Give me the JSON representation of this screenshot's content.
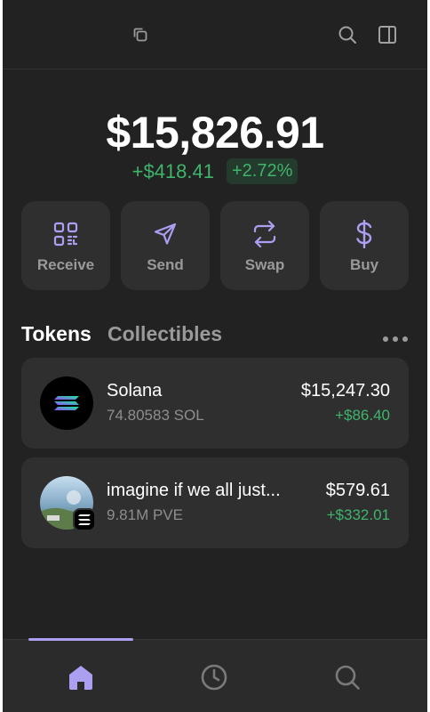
{
  "header": {
    "copy_icon": "copy-icon",
    "search_icon": "search-icon",
    "sidebar_icon": "sidebar-toggle-icon"
  },
  "balance": {
    "total": "$15,826.91",
    "change_amount": "+$418.41",
    "change_percent": "+2.72%"
  },
  "actions": [
    {
      "label": "Receive",
      "icon": "qr-code-icon"
    },
    {
      "label": "Send",
      "icon": "send-icon"
    },
    {
      "label": "Swap",
      "icon": "swap-icon"
    },
    {
      "label": "Buy",
      "icon": "dollar-icon"
    }
  ],
  "tabs": {
    "active": "Tokens",
    "inactive": "Collectibles"
  },
  "tokens": [
    {
      "name": "Solana",
      "amount": "74.80583 SOL",
      "value": "$15,247.30",
      "change": "+$86.40"
    },
    {
      "name": "imagine if we all just...",
      "amount": "9.81M PVE",
      "value": "$579.61",
      "change": "+$332.01"
    }
  ],
  "colors": {
    "background": "#222222",
    "card": "#2f2f2f",
    "accent": "#ab9ff2",
    "positive": "#3fb46b"
  },
  "nav": [
    {
      "icon": "home-icon",
      "active": true
    },
    {
      "icon": "history-icon",
      "active": false
    },
    {
      "icon": "search-icon",
      "active": false
    }
  ]
}
